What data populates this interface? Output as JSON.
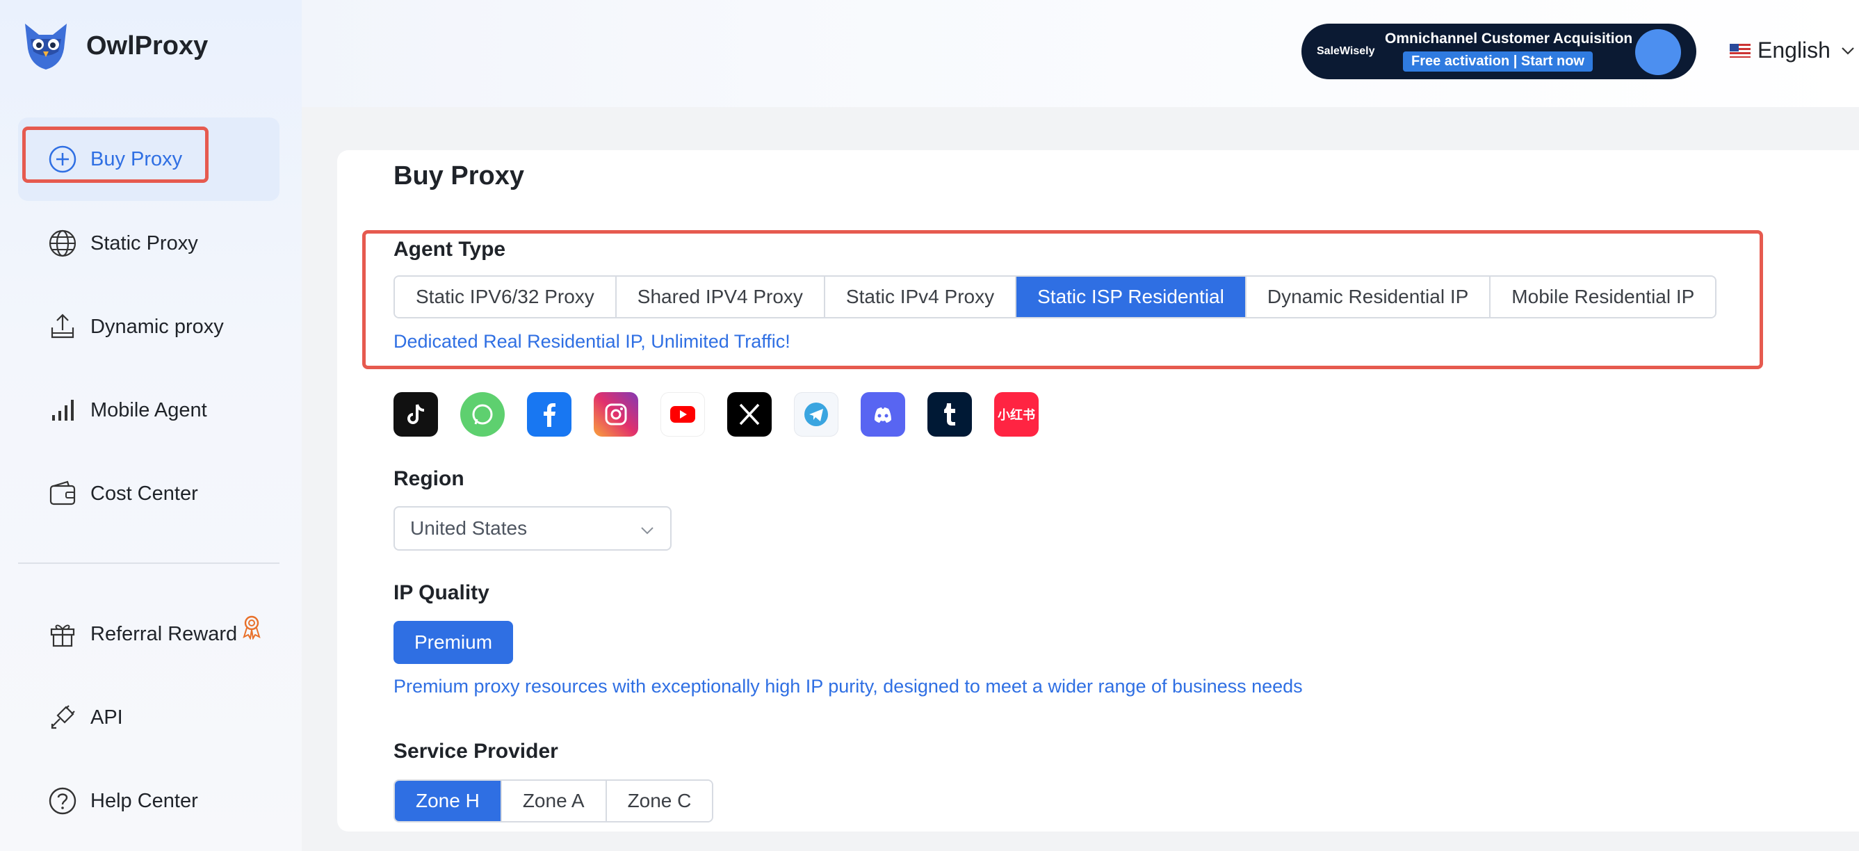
{
  "app": {
    "name": "OwlProxy"
  },
  "sidebar": {
    "items": [
      {
        "label": "Buy Proxy",
        "icon": "plus-circle-icon",
        "active": true
      },
      {
        "label": "Static Proxy",
        "icon": "globe-icon"
      },
      {
        "label": "Dynamic proxy",
        "icon": "upload-tray-icon"
      },
      {
        "label": "Mobile Agent",
        "icon": "signal-bars-icon"
      },
      {
        "label": "Cost Center",
        "icon": "wallet-icon"
      },
      {
        "label": "Referral Reward",
        "icon": "gift-icon",
        "badge_icon": "award-ribbon-icon"
      },
      {
        "label": "API",
        "icon": "plug-icon"
      },
      {
        "label": "Help Center",
        "icon": "question-circle-icon"
      }
    ]
  },
  "header": {
    "banner": {
      "brand": "SaleWisely",
      "title": "Omnichannel Customer Acquisition",
      "cta": "Free activation | Start now"
    },
    "language": {
      "label": "English",
      "flag": "us-flag-icon"
    }
  },
  "main": {
    "title": "Buy Proxy",
    "agent_type": {
      "label": "Agent Type",
      "options": [
        "Static IPV6/32 Proxy",
        "Shared IPV4 Proxy",
        "Static IPv4 Proxy",
        "Static ISP Residential",
        "Dynamic Residential IP",
        "Mobile Residential IP"
      ],
      "selected": "Static ISP Residential",
      "hint": "Dedicated Real Residential IP, Unlimited Traffic!"
    },
    "social_icons": [
      "tiktok-icon",
      "whatsapp-icon",
      "facebook-icon",
      "instagram-icon",
      "youtube-icon",
      "x-icon",
      "telegram-icon",
      "discord-icon",
      "tumblr-icon",
      "xiaohongshu-icon"
    ],
    "xiaohongshu_text": "小红书",
    "region": {
      "label": "Region",
      "value": "United States"
    },
    "ip_quality": {
      "label": "IP Quality",
      "option": "Premium",
      "hint": "Premium proxy resources with exceptionally high IP purity, designed to meet a wider range of business needs"
    },
    "service_provider": {
      "label": "Service Provider",
      "options": [
        "Zone H",
        "Zone A",
        "Zone C"
      ],
      "selected": "Zone H"
    }
  },
  "colors": {
    "accent": "#2f6fe3",
    "highlight": "#e65a4f"
  }
}
